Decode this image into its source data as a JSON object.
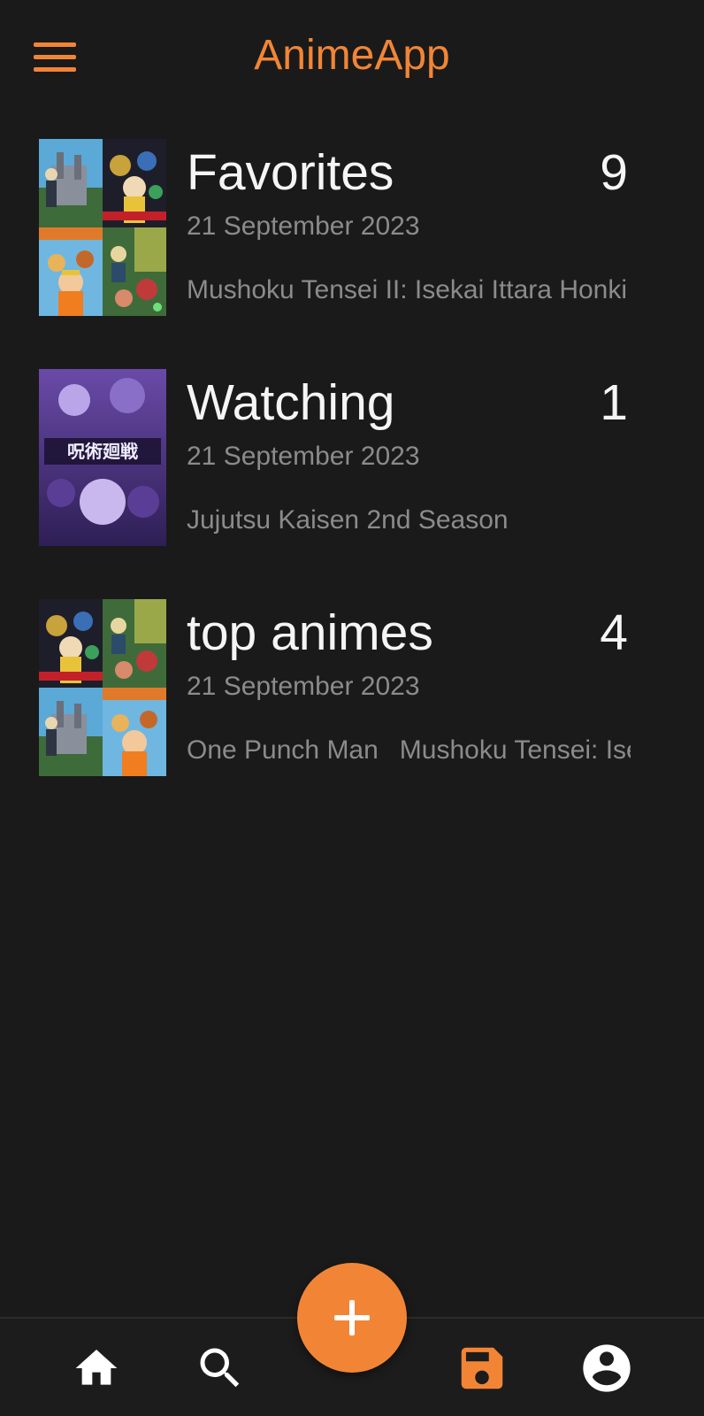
{
  "app": {
    "title": "AnimeApp",
    "accent_color": "#f28535",
    "background_color": "#1a1a1a"
  },
  "header": {
    "menu_icon": "hamburger-menu-icon"
  },
  "lists": [
    {
      "title": "Favorites",
      "count": "9",
      "date": "21 September 2023",
      "preview": [
        "Mushoku Tensei II: Isekai Ittara Honki Dasu"
      ],
      "cover": "collage"
    },
    {
      "title": "Watching",
      "count": "1",
      "date": "21 September 2023",
      "preview": [
        "Jujutsu Kaisen 2nd Season"
      ],
      "cover": "single"
    },
    {
      "title": "top animes",
      "count": "4",
      "date": "21 September 2023",
      "preview": [
        "One Punch Man",
        "Mushoku Tensei: Isekai Ittara Honki Dasu"
      ],
      "cover": "collage"
    }
  ],
  "bottom_nav": {
    "items": [
      {
        "icon": "home-icon",
        "active": false
      },
      {
        "icon": "search-icon",
        "active": false
      },
      {
        "icon": "save-icon",
        "active": true
      },
      {
        "icon": "account-icon",
        "active": false
      }
    ],
    "fab_icon": "plus-icon",
    "inactive_color": "#ffffff"
  }
}
